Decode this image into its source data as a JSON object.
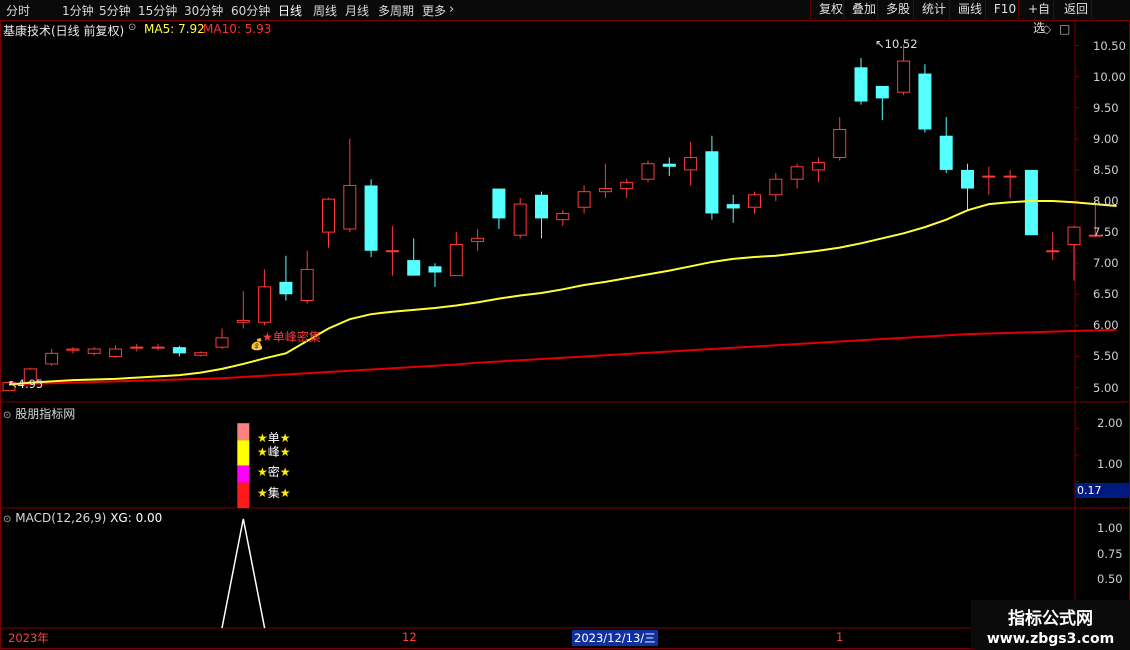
{
  "toolbar": {
    "period_tabs": [
      "分时",
      "1分钟",
      "5分钟",
      "15分钟",
      "30分钟",
      "60分钟",
      "日线",
      "周线",
      "月线",
      "多周期",
      "更多"
    ],
    "more_arrow": "›",
    "right_buttons": [
      "复权",
      "叠加",
      "多股",
      "统计",
      "画线",
      "F10",
      "+自选",
      "返回"
    ]
  },
  "main_panel": {
    "stock_title": "基康技术(日线 前复权)",
    "ma5_label": "MA5: 7.92",
    "ma10_label": "MA10: 5.93",
    "high_annotation": "10.52",
    "low_annotation": "4.95",
    "signal_text": "单峰密集",
    "price_ticks": [
      "10.50",
      "10.00",
      "9.50",
      "9.00",
      "8.50",
      "8.00",
      "7.50",
      "7.00",
      "6.50",
      "6.00",
      "5.50",
      "5.00"
    ]
  },
  "indicator_panel": {
    "title": "股朋指标网",
    "ticks": [
      "2.00",
      "1.00"
    ],
    "current_value": "0.17",
    "signal_chars": [
      "单",
      "峰",
      "密",
      "集"
    ],
    "star": "★"
  },
  "macd_panel": {
    "title": "MACD(12,26,9)",
    "xg_label": "XG: 0.00",
    "ticks": [
      "1.00",
      "0.75",
      "0.50"
    ]
  },
  "date_axis": {
    "labels": [
      "2023年",
      "12",
      "2023/12/13/三",
      "1"
    ]
  },
  "watermark": {
    "line1": "指标公式网",
    "line2": "www.zbgs3.com"
  },
  "colors": {
    "up": "#ff3a3a",
    "down": "#54ffff",
    "ma5": "#ffff33",
    "ma10": "#e00000",
    "grid": "#7a0000"
  },
  "chart_data": {
    "type": "candlestick",
    "y_range": [
      4.8,
      10.75
    ],
    "candles": [
      {
        "o": 4.95,
        "c": 5.08,
        "h": 5.1,
        "l": 4.95
      },
      {
        "o": 5.08,
        "c": 5.3,
        "h": 5.32,
        "l": 5.05
      },
      {
        "o": 5.38,
        "c": 5.55,
        "h": 5.62,
        "l": 5.35
      },
      {
        "o": 5.6,
        "c": 5.62,
        "h": 5.65,
        "l": 5.55
      },
      {
        "o": 5.55,
        "c": 5.62,
        "h": 5.65,
        "l": 5.52
      },
      {
        "o": 5.5,
        "c": 5.62,
        "h": 5.68,
        "l": 5.48
      },
      {
        "o": 5.65,
        "c": 5.65,
        "h": 5.7,
        "l": 5.58
      },
      {
        "o": 5.65,
        "c": 5.65,
        "h": 5.7,
        "l": 5.6
      },
      {
        "o": 5.65,
        "c": 5.55,
        "h": 5.67,
        "l": 5.5
      },
      {
        "o": 5.52,
        "c": 5.56,
        "h": 5.58,
        "l": 5.5
      },
      {
        "o": 5.65,
        "c": 5.8,
        "h": 5.95,
        "l": 5.62
      },
      {
        "o": 6.05,
        "c": 6.08,
        "h": 6.55,
        "l": 5.95
      },
      {
        "o": 6.05,
        "c": 6.62,
        "h": 6.9,
        "l": 6.0
      },
      {
        "o": 6.7,
        "c": 6.5,
        "h": 7.12,
        "l": 6.4
      },
      {
        "o": 6.4,
        "c": 6.9,
        "h": 7.2,
        "l": 6.35
      },
      {
        "o": 7.5,
        "c": 8.03,
        "h": 8.05,
        "l": 7.25
      },
      {
        "o": 7.55,
        "c": 8.25,
        "h": 9.0,
        "l": 7.5
      },
      {
        "o": 8.25,
        "c": 7.2,
        "h": 8.35,
        "l": 7.1
      },
      {
        "o": 7.2,
        "c": 7.2,
        "h": 7.6,
        "l": 6.8
      },
      {
        "o": 7.05,
        "c": 6.8,
        "h": 7.4,
        "l": 6.8
      },
      {
        "o": 6.95,
        "c": 6.85,
        "h": 7.0,
        "l": 6.62
      },
      {
        "o": 6.8,
        "c": 7.3,
        "h": 7.5,
        "l": 6.8
      },
      {
        "o": 7.35,
        "c": 7.4,
        "h": 7.55,
        "l": 7.2
      },
      {
        "o": 8.2,
        "c": 7.72,
        "h": 8.2,
        "l": 7.55
      },
      {
        "o": 7.45,
        "c": 7.95,
        "h": 8.05,
        "l": 7.4
      },
      {
        "o": 8.1,
        "c": 7.72,
        "h": 8.15,
        "l": 7.4
      },
      {
        "o": 7.7,
        "c": 7.8,
        "h": 7.85,
        "l": 7.6
      },
      {
        "o": 7.9,
        "c": 8.15,
        "h": 8.25,
        "l": 7.8
      },
      {
        "o": 8.15,
        "c": 8.2,
        "h": 8.6,
        "l": 8.05
      },
      {
        "o": 8.2,
        "c": 8.3,
        "h": 8.35,
        "l": 8.05
      },
      {
        "o": 8.35,
        "c": 8.6,
        "h": 8.65,
        "l": 8.3
      },
      {
        "o": 8.6,
        "c": 8.55,
        "h": 8.7,
        "l": 8.4
      },
      {
        "o": 8.5,
        "c": 8.7,
        "h": 8.95,
        "l": 8.25
      },
      {
        "o": 8.8,
        "c": 7.8,
        "h": 9.05,
        "l": 7.7
      },
      {
        "o": 7.95,
        "c": 7.88,
        "h": 8.1,
        "l": 7.65
      },
      {
        "o": 7.9,
        "c": 8.1,
        "h": 8.15,
        "l": 7.8
      },
      {
        "o": 8.1,
        "c": 8.35,
        "h": 8.45,
        "l": 8.0
      },
      {
        "o": 8.35,
        "c": 8.55,
        "h": 8.6,
        "l": 8.2
      },
      {
        "o": 8.5,
        "c": 8.62,
        "h": 8.7,
        "l": 8.3
      },
      {
        "o": 8.7,
        "c": 9.15,
        "h": 9.35,
        "l": 8.65
      },
      {
        "o": 10.15,
        "c": 9.6,
        "h": 10.3,
        "l": 9.55
      },
      {
        "o": 9.85,
        "c": 9.65,
        "h": 9.85,
        "l": 9.3
      },
      {
        "o": 9.75,
        "c": 10.25,
        "h": 10.52,
        "l": 9.7
      },
      {
        "o": 10.05,
        "c": 9.15,
        "h": 10.2,
        "l": 9.1
      },
      {
        "o": 9.05,
        "c": 8.5,
        "h": 9.35,
        "l": 8.45
      },
      {
        "o": 8.5,
        "c": 8.2,
        "h": 8.6,
        "l": 7.85
      },
      {
        "o": 8.4,
        "c": 8.4,
        "h": 8.55,
        "l": 8.1
      },
      {
        "o": 8.4,
        "c": 8.4,
        "h": 8.5,
        "l": 8.05
      },
      {
        "o": 8.5,
        "c": 7.45,
        "h": 8.5,
        "l": 7.45
      },
      {
        "o": 7.2,
        "c": 7.2,
        "h": 7.5,
        "l": 7.05
      },
      {
        "o": 7.3,
        "c": 7.58,
        "h": 7.6,
        "l": 6.72
      },
      {
        "o": 7.45,
        "c": 7.45,
        "h": 8.0,
        "l": 7.45
      }
    ],
    "ma5": [
      5.05,
      5.08,
      5.1,
      5.12,
      5.13,
      5.14,
      5.16,
      5.18,
      5.2,
      5.24,
      5.3,
      5.38,
      5.47,
      5.55,
      5.75,
      5.95,
      6.1,
      6.18,
      6.22,
      6.25,
      6.28,
      6.32,
      6.37,
      6.43,
      6.48,
      6.52,
      6.58,
      6.65,
      6.7,
      6.76,
      6.82,
      6.88,
      6.95,
      7.02,
      7.07,
      7.1,
      7.12,
      7.16,
      7.2,
      7.25,
      7.32,
      7.4,
      7.48,
      7.58,
      7.7,
      7.85,
      7.95,
      7.98,
      8.0,
      8.0,
      7.98,
      7.95,
      7.92
    ],
    "ma10": [
      5.05,
      5.06,
      5.07,
      5.08,
      5.09,
      5.1,
      5.11,
      5.12,
      5.13,
      5.14,
      5.15,
      5.17,
      5.19,
      5.21,
      5.23,
      5.25,
      5.27,
      5.29,
      5.31,
      5.33,
      5.35,
      5.37,
      5.4,
      5.42,
      5.44,
      5.46,
      5.48,
      5.5,
      5.52,
      5.54,
      5.56,
      5.58,
      5.6,
      5.62,
      5.64,
      5.66,
      5.68,
      5.7,
      5.72,
      5.74,
      5.76,
      5.78,
      5.8,
      5.82,
      5.84,
      5.86,
      5.87,
      5.88,
      5.89,
      5.9,
      5.91,
      5.92,
      5.93
    ],
    "signal_bar_index": 11,
    "indicator_range": [
      0,
      2.5
    ],
    "macd_xg_range": [
      0,
      1.1
    ],
    "macd_xg_values": [
      0,
      0,
      0,
      0,
      0,
      0,
      0,
      0,
      0,
      0,
      0,
      1,
      0,
      0,
      0,
      0,
      0,
      0,
      0,
      0,
      0,
      0,
      0,
      0,
      0,
      0,
      0,
      0,
      0,
      0,
      0,
      0,
      0,
      0,
      0,
      0,
      0,
      0,
      0,
      0,
      0,
      0,
      0,
      0,
      0,
      0,
      0,
      0,
      0,
      0,
      0,
      0
    ]
  }
}
